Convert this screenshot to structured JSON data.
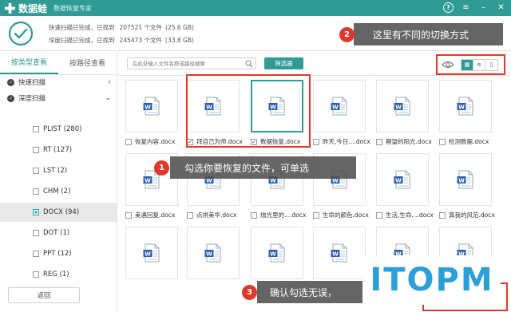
{
  "app": {
    "name": "数据蛙",
    "subtitle": "数据恢复专家",
    "accent_color": "#2f9b94",
    "icons": {
      "help": "help-icon",
      "menu": "menu-icon",
      "minimize": "minimize-icon",
      "close": "close-icon"
    }
  },
  "scan": {
    "quick": {
      "text": "快速扫描已完成，已找到",
      "count": "207521 个文件",
      "size": "(25.6 GB)"
    },
    "deep": {
      "text": "深度扫描已完成，已找到",
      "count": "245473 个文件",
      "size": "(33.8 GB)"
    }
  },
  "sidebar": {
    "tabs": [
      {
        "label": "按类型查看",
        "active": true
      },
      {
        "label": "按路径查看",
        "active": false
      }
    ],
    "categories": [
      {
        "label": "快速扫描"
      },
      {
        "label": "深度扫描"
      }
    ],
    "filetypes": [
      {
        "label": "PLIST (280)",
        "selected": false
      },
      {
        "label": "RT (127)",
        "selected": false
      },
      {
        "label": "LST (2)",
        "selected": false
      },
      {
        "label": "CHM (2)",
        "selected": false
      },
      {
        "label": "DOCX (94)",
        "selected": true
      },
      {
        "label": "DOT (1)",
        "selected": false
      },
      {
        "label": "PPT (12)",
        "selected": false
      },
      {
        "label": "REG (1)",
        "selected": false
      },
      {
        "label": "URL (3)",
        "selected": false
      }
    ],
    "back_label": "返回"
  },
  "toolbar": {
    "search_placeholder": "在此处输入文件名称或路径搜索",
    "filter_label": "筛选器",
    "view_modes": [
      "thumbnail-view-icon",
      "list-view-icon",
      "detail-view-icon"
    ]
  },
  "files": [
    {
      "name": "恢复内容.docx",
      "checked": false,
      "selected": false
    },
    {
      "name": "拜自己为师.docx",
      "checked": true,
      "selected": false
    },
    {
      "name": "数据恢复.docx",
      "checked": true,
      "selected": true
    },
    {
      "name": "昨天,今日....docx",
      "checked": false,
      "selected": false
    },
    {
      "name": "期望的阳光.docx",
      "checked": false,
      "selected": false
    },
    {
      "name": "检测数据.docx",
      "checked": false,
      "selected": false
    },
    {
      "name": "美遇回复.docx",
      "checked": false,
      "selected": false
    },
    {
      "name": "点拼美华.docx",
      "checked": false,
      "selected": false
    },
    {
      "name": "烛光里的....docx",
      "checked": false,
      "selected": false
    },
    {
      "name": "生命的颜色.docx",
      "checked": false,
      "selected": false
    },
    {
      "name": "生活,生命....docx",
      "checked": false,
      "selected": false
    },
    {
      "name": "真我的风范.docx",
      "checked": false,
      "selected": false
    },
    {
      "name": "",
      "checked": false,
      "selected": false
    },
    {
      "name": "",
      "checked": false,
      "selected": false
    },
    {
      "name": "",
      "checked": false,
      "selected": false
    },
    {
      "name": "",
      "checked": false,
      "selected": false
    },
    {
      "name": "",
      "checked": false,
      "selected": false
    },
    {
      "name": "",
      "checked": false,
      "selected": false
    }
  ],
  "annotations": [
    {
      "number": "1",
      "text": "勾选你要恢复的文件，可单选"
    },
    {
      "number": "2",
      "text": "这里有不同的切换方式"
    },
    {
      "number": "3",
      "text": "确认勾选无误，"
    }
  ],
  "annotation_color": "#e0392b",
  "watermark": "ITOPM"
}
